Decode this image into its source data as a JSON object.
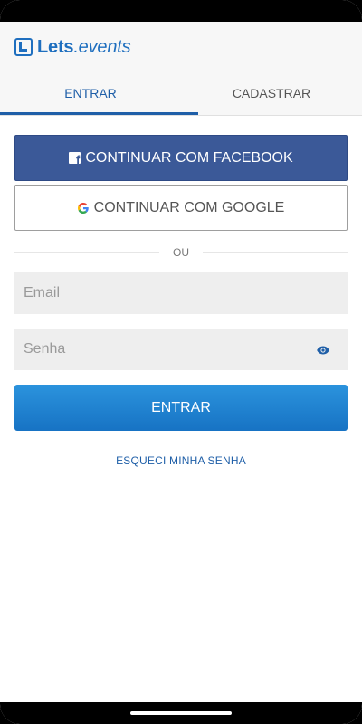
{
  "app": {
    "logo_bold": "Lets",
    "logo_italic": ".events",
    "brand_color": "#1f6fbf"
  },
  "tabs": [
    {
      "label": "ENTRAR",
      "active": true
    },
    {
      "label": "CADASTRAR",
      "active": false
    }
  ],
  "social": {
    "facebook_label": "CONTINUAR COM FACEBOOK",
    "facebook_icon": "facebook-icon",
    "facebook_color": "#3b5998",
    "google_label": "CONTINUAR COM GOOGLE",
    "google_icon": "google-icon"
  },
  "divider_text": "OU",
  "form": {
    "email_placeholder": "Email",
    "email_value": "",
    "password_placeholder": "Senha",
    "password_value": "",
    "password_toggle_icon": "eye-icon",
    "submit_label": "ENTRAR",
    "submit_color": "#1f82d0"
  },
  "forgot_password_label": "ESQUECI MINHA SENHA"
}
